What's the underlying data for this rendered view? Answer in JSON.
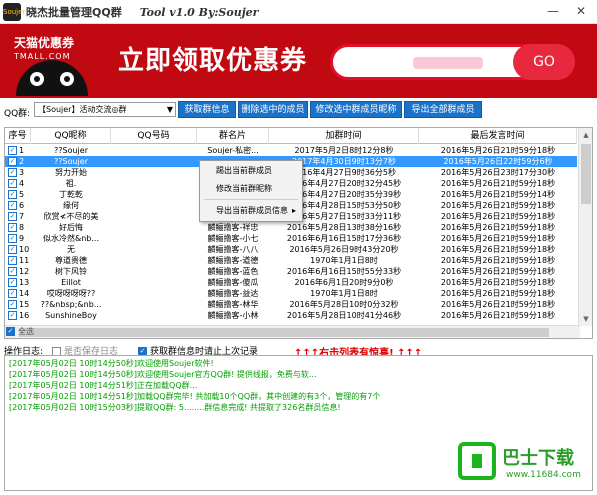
{
  "window": {
    "title_cn": "晓杰批量管理QQ群",
    "title_en": "Tool v1.0 By:Soujer",
    "minimize": "—",
    "close": "✕",
    "icon_text": "Soujer"
  },
  "banner": {
    "brand": "天猫优惠券",
    "brand_url": "TMALL.COM",
    "slogan": "立即领取优惠券",
    "go": "GO"
  },
  "toolbar": {
    "group_label": "QQ群:",
    "group_selected": "【Soujer】活动交流◎群",
    "buttons": [
      "获取群信息",
      "删除选中的成员",
      "修改选中群成员昵称",
      "导出全部群成员"
    ]
  },
  "table": {
    "headers": [
      "序号",
      "QQ昵称",
      "QQ号码",
      "群名片",
      "加群时间",
      "最后发言时间"
    ],
    "rows": [
      {
        "idx": "1",
        "nick": "??Soujer",
        "qq": "",
        "card": "Soujer-私密...",
        "join": "2017年5月2日8时12分8秒",
        "last": "2016年5月26日21时59分18秒"
      },
      {
        "idx": "2",
        "nick": "??Soujer",
        "qq": "",
        "card": "",
        "join": "2017年4月30日9时13分7秒",
        "last": "2016年5月26日22时59分6秒"
      },
      {
        "idx": "3",
        "nick": "努力开始",
        "qq": "",
        "card": "",
        "join": "2016年4月27日9时36分5秒",
        "last": "2016年5月26日23时17分30秒"
      },
      {
        "idx": "4",
        "nick": "祖.",
        "qq": "",
        "card": "",
        "join": "2016年4月27日20时32分45秒",
        "last": "2016年5月26日21时59分18秒"
      },
      {
        "idx": "5",
        "nick": "丁乾乾",
        "qq": "",
        "card": "",
        "join": "2016年4月27日20时35分39秒",
        "last": "2016年5月26日21时59分14秒"
      },
      {
        "idx": "6",
        "nick": "缘何",
        "qq": "",
        "card": "",
        "join": "2016年4月28日15时53分50秒",
        "last": "2016年5月26日21时59分18秒"
      },
      {
        "idx": "7",
        "nick": "欣赏≮不尽的美",
        "qq": "",
        "card": "",
        "join": "2016年5月27日15时33分11秒",
        "last": "2016年5月26日21时59分18秒"
      },
      {
        "idx": "8",
        "nick": "好后悔",
        "qq": "",
        "card": "麟鲡撸客-祥忠",
        "join": "2016年5月28日13时38分16秒",
        "last": "2016年5月26日21时59分18秒"
      },
      {
        "idx": "9",
        "nick": "似水冷然&nb...",
        "qq": "",
        "card": "麟鲡撸客-小七",
        "join": "2016年6月16日15时17分36秒",
        "last": "2016年5月26日21时59分18秒"
      },
      {
        "idx": "10",
        "nick": "无",
        "qq": "",
        "card": "麟鲡撸客-八八",
        "join": "2016年5月26日9时43分20秒",
        "last": "2016年5月26日21时59分18秒"
      },
      {
        "idx": "11",
        "nick": "尊道贵德",
        "qq": "",
        "card": "麟鲡撸客-道德",
        "join": "1970年1月1日8时",
        "last": "2016年5月26日21时59分18秒"
      },
      {
        "idx": "12",
        "nick": "树下风铃",
        "qq": "",
        "card": "麟鲡撸客-蓝色",
        "join": "2016年6月16日15时55分33秒",
        "last": "2016年5月26日21时59分18秒"
      },
      {
        "idx": "13",
        "nick": "Eillot",
        "qq": "",
        "card": "麟鲡撸客-傻瓜",
        "join": "2016年6月1日20时9分0秒",
        "last": "2016年5月26日21时59分18秒"
      },
      {
        "idx": "14",
        "nick": "哎呀呀呀呀??",
        "qq": "",
        "card": "麟鲡撸客-益达",
        "join": "1970年1月1日8时",
        "last": "2016年5月26日21时59分18秒"
      },
      {
        "idx": "15",
        "nick": "??&nbsp;&nb...",
        "qq": "",
        "card": "麟鲡撸客-林华",
        "join": "2016年5月28日10时0分32秒",
        "last": "2016年5月26日21时59分18秒"
      },
      {
        "idx": "16",
        "nick": "SunshineBoy",
        "qq": "",
        "card": "麟鲡撸客-小林",
        "join": "2016年5月28日10时41分46秒",
        "last": "2016年5月26日21时59分18秒"
      }
    ],
    "select_all": "全选"
  },
  "context_menu": {
    "items": [
      "踢出当前群成员",
      "修改当前群昵称",
      "导出当前群成员信息"
    ]
  },
  "options": {
    "log_label": "操作日志:",
    "save_log": "是否保存日志",
    "auto_get": "获取群信息时请止上次记录",
    "warning": "↑↑↑右击列表有惊喜! ↑↑↑"
  },
  "log": [
    "[2017年05月02日 10时14分50秒]欢迎使用Soujer软件!",
    "[2017年05月02日 10时14分50秒]欢迎使用Soujer官方QQ群! 提供线报，免费与软...",
    "[2017年05月02日 10时14分51秒]正在加载QQ群...",
    "[2017年05月02日 10时14分51秒]加载QQ群完毕! 共加载10个QQ群，其中创建的有3个，管理的有7个",
    "[2017年05月02日 10时15分03秒]提取QQ群: 5........群信息完成! 共提取了326名群员信息!"
  ],
  "watermark": {
    "text": "巴士下载",
    "url": "www.11684.com"
  }
}
